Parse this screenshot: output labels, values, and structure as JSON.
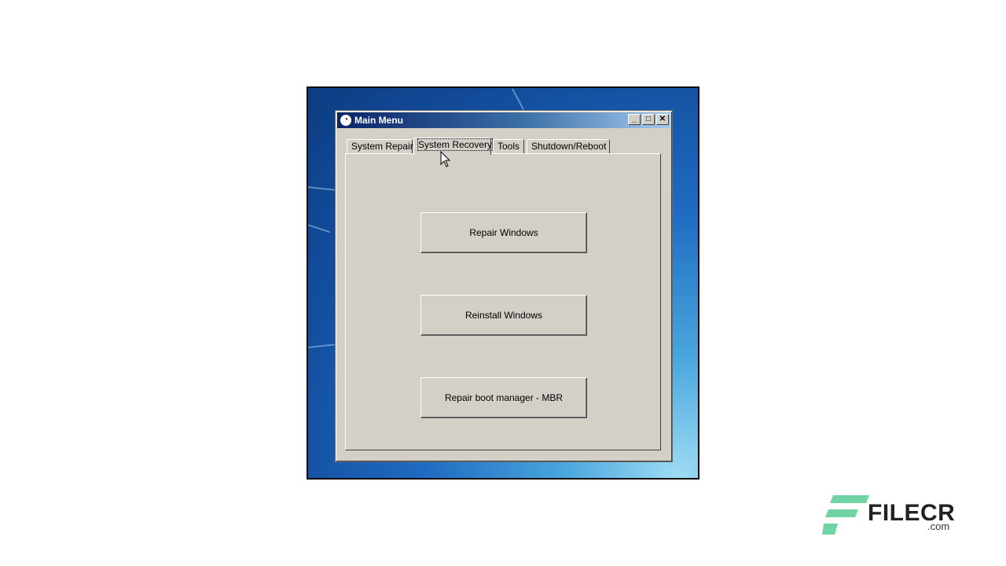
{
  "window": {
    "title": "Main Menu",
    "controls": {
      "minimize": "_",
      "maximize": "□",
      "close": "✕"
    }
  },
  "tabs": [
    {
      "label": "System Repair",
      "active": false
    },
    {
      "label": "System Recovery",
      "active": true
    },
    {
      "label": "Tools",
      "active": false
    },
    {
      "label": "Shutdown/Reboot",
      "active": false
    }
  ],
  "buttons": {
    "repair_windows": "Repair Windows",
    "reinstall_windows": "Reinstall Windows",
    "repair_boot_manager": "Repair boot manager - MBR"
  },
  "watermark": {
    "brand": "FILECR",
    "suffix": ".com",
    "accent_color": "#6fd3a4"
  },
  "colors": {
    "dialog_face": "#d4d0c8",
    "titlebar_start": "#0a246a",
    "desktop_blue": "#1f6cc2"
  }
}
